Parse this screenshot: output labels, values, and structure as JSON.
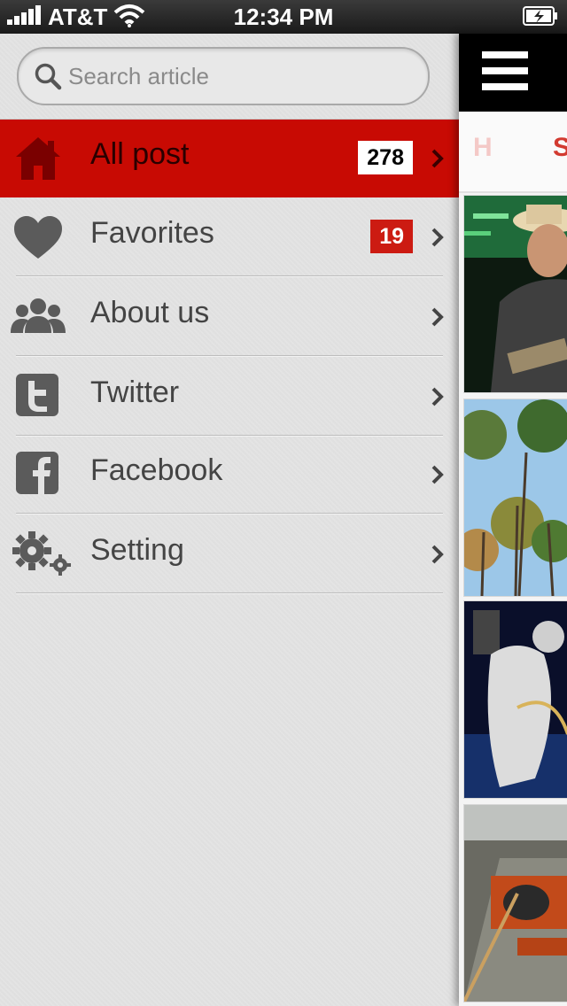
{
  "status_bar": {
    "carrier": "AT&T",
    "time": "12:34 PM"
  },
  "search": {
    "placeholder": "Search article"
  },
  "menu": {
    "items": [
      {
        "label": "All post",
        "icon": "home-icon",
        "badge": "278",
        "active": true
      },
      {
        "label": "Favorites",
        "icon": "heart-icon",
        "badge": "19",
        "active": false
      },
      {
        "label": "About us",
        "icon": "users-icon",
        "active": false
      },
      {
        "label": "Twitter",
        "icon": "twitter-icon",
        "active": false
      },
      {
        "label": "Facebook",
        "icon": "facebook-icon",
        "active": false
      },
      {
        "label": "Setting",
        "icon": "gear-icon",
        "active": false
      }
    ]
  },
  "content": {
    "tabs": [
      "H",
      "S"
    ],
    "thumbnails": [
      "concert-photo",
      "trees-photo",
      "astronaut-photo",
      "tunnel-photo"
    ]
  },
  "colors": {
    "accent": "#c80a03",
    "badge_red": "#cc1b12",
    "header": "#000000"
  }
}
